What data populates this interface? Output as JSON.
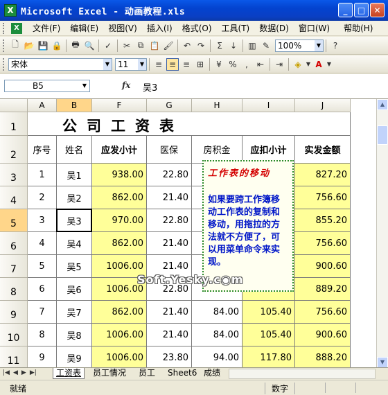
{
  "window": {
    "title": "Microsoft Excel - 动画教程.xls"
  },
  "menu": [
    "文件(F)",
    "编辑(E)",
    "视图(V)",
    "插入(I)",
    "格式(O)",
    "工具(T)",
    "数据(D)",
    "窗口(W)",
    "帮助(H)"
  ],
  "toolbar": {
    "zoom": "100%",
    "font": "宋体",
    "size": "11"
  },
  "formula": {
    "cell": "B5",
    "fx": "fx",
    "value": "吴3"
  },
  "columns": [
    "A",
    "B",
    "F",
    "G",
    "H",
    "I",
    "J"
  ],
  "title_text": "公司工资表",
  "headers": [
    "序号",
    "姓名",
    "应发小计",
    "医保",
    "房积金",
    "应扣小计",
    "实发金额"
  ],
  "rows": [
    [
      "1",
      "吴1",
      "938.00",
      "22.80",
      "",
      "",
      "827.20"
    ],
    [
      "2",
      "吴2",
      "862.00",
      "21.40",
      "",
      "",
      "756.60"
    ],
    [
      "3",
      "吴3",
      "970.00",
      "22.80",
      "",
      "",
      "855.20"
    ],
    [
      "4",
      "吴4",
      "862.00",
      "21.40",
      "",
      "",
      "756.60"
    ],
    [
      "5",
      "吴5",
      "1006.00",
      "21.40",
      "",
      "",
      "900.60"
    ],
    [
      "6",
      "吴6",
      "1006.00",
      "22.80",
      "",
      "",
      "889.20"
    ],
    [
      "7",
      "吴7",
      "862.00",
      "21.40",
      "84.00",
      "105.40",
      "756.60"
    ],
    [
      "8",
      "吴8",
      "1006.00",
      "21.40",
      "84.00",
      "105.40",
      "900.60"
    ],
    [
      "9",
      "吴9",
      "1006.00",
      "23.80",
      "94.00",
      "117.80",
      "888.20"
    ]
  ],
  "row_numbers": [
    "1",
    "2",
    "3",
    "4",
    "5",
    "6",
    "7",
    "8",
    "9",
    "10",
    "11"
  ],
  "note": {
    "title": "工作表的移动",
    "body": "如果要跨工作簿移动工作表的复制和移动，用拖拉的方法就不方便了，可以用菜单命令来实现。"
  },
  "watermark": "Soft.Yesky.c◉m",
  "tabs": [
    "工资表",
    "员工情况",
    "员工",
    "Sheet6",
    "成绩"
  ],
  "status": {
    "left": "就绪",
    "num": "数字"
  }
}
